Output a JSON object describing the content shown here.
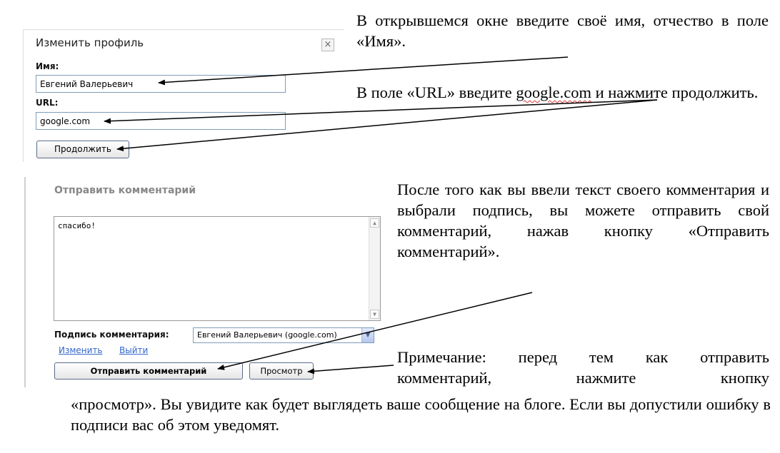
{
  "profile_dialog": {
    "title": "Изменить профиль",
    "close_glyph": "×",
    "name_label": "Имя:",
    "name_value": "Евгений Валерьевич",
    "url_label": "URL:",
    "url_value": "google.com",
    "continue_button": "Продолжить"
  },
  "instructions": {
    "step1": "В открывшемся окне введите своё имя, отчество в поле «Имя».",
    "step2_before": "В поле «URL» введите ",
    "step2_link": "google.com",
    "step2_after": " и нажмите продолжить.",
    "step3": "После того как вы ввели текст своего комментария и выбрали подпись, вы можете отправить свой комментарий, нажав кнопку «Отправить комментарий».",
    "note_line1": "Примечание: перед тем как отправить",
    "note_line2": "комментарий, нажмите кнопку",
    "note_rest": "«просмотр». Вы увидите как будет выглядеть ваше сообщение на блоге. Если вы допустили ошибку в подписи вас об этом уведомят."
  },
  "comment_dialog": {
    "title": "Отправить комментарий",
    "comment_text": "спасибо!",
    "signature_label": "Подпись комментария:",
    "signature_value": "Евгений Валерьевич (google.com)",
    "edit_link": "Изменить",
    "logout_link": "Выйти",
    "submit_button": "Отправить комментарий",
    "preview_button": "Просмотр"
  },
  "icons": {
    "close": "close-icon",
    "scroll_up": "arrow-up-icon",
    "scroll_down": "arrow-down-icon",
    "dropdown": "chevron-down-icon"
  },
  "colors": {
    "link": "#3366cc",
    "field_border": "#7f9db9",
    "spellcheck": "#dd3333"
  }
}
